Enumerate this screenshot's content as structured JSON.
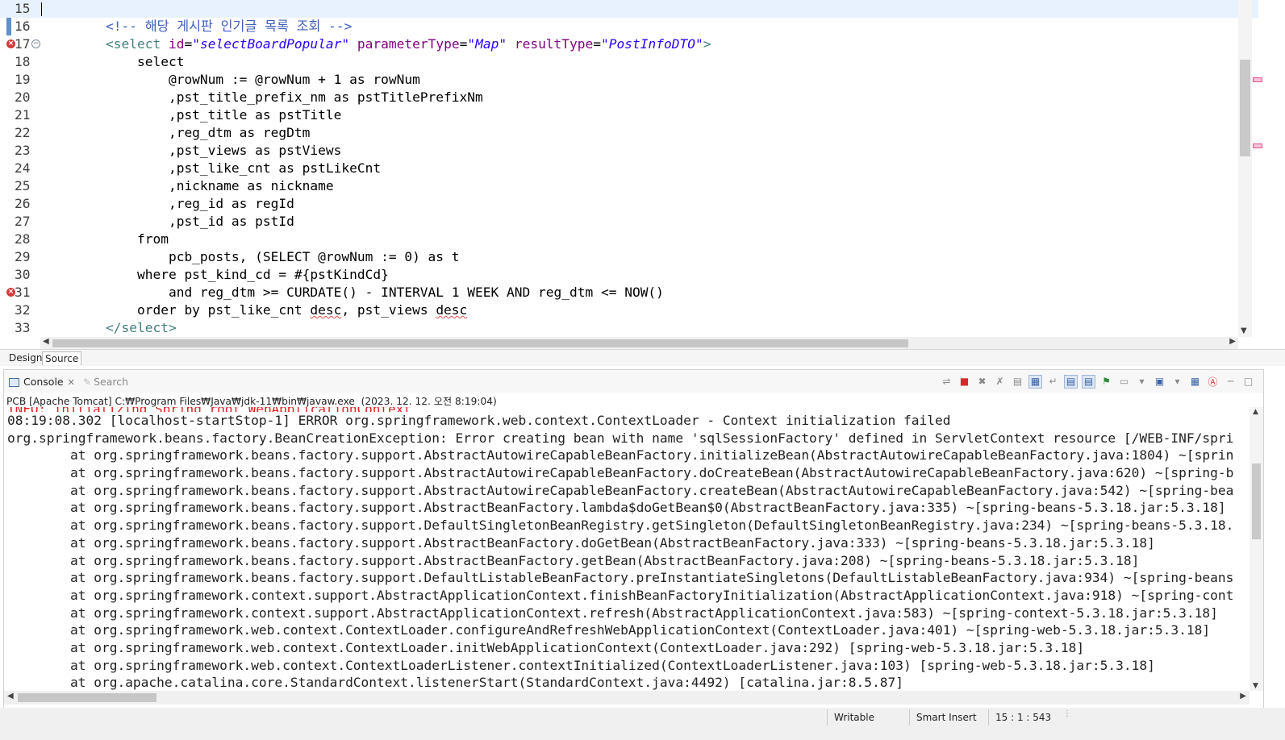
{
  "editor": {
    "lines": [
      {
        "n": "15",
        "segs": []
      },
      {
        "n": "16",
        "segs": [
          {
            "t": "    "
          },
          {
            "t": "<!-- 해당 게시판 인기글 목록 조회 -->",
            "c": "c-comment"
          }
        ]
      },
      {
        "n": "17",
        "segs": [
          {
            "t": "    "
          },
          {
            "t": "<select",
            "c": "c-tag"
          },
          {
            "t": " "
          },
          {
            "t": "id",
            "c": "c-attr"
          },
          {
            "t": "="
          },
          {
            "t": "\"selectBoardPopular\"",
            "c": "c-val"
          },
          {
            "t": " "
          },
          {
            "t": "parameterType",
            "c": "c-attr"
          },
          {
            "t": "="
          },
          {
            "t": "\"Map\"",
            "c": "c-val"
          },
          {
            "t": " "
          },
          {
            "t": "resultType",
            "c": "c-attr"
          },
          {
            "t": "="
          },
          {
            "t": "\"PostInfoDTO\"",
            "c": "c-val"
          },
          {
            "t": ">",
            "c": "c-tag"
          }
        ]
      },
      {
        "n": "18",
        "segs": [
          {
            "t": "        select"
          }
        ]
      },
      {
        "n": "19",
        "segs": [
          {
            "t": "            @rowNum := @rowNum + 1 as rowNum"
          }
        ]
      },
      {
        "n": "20",
        "segs": [
          {
            "t": "            ,pst_title_prefix_nm as pstTitlePrefixNm"
          }
        ]
      },
      {
        "n": "21",
        "segs": [
          {
            "t": "            ,pst_title as pstTitle"
          }
        ]
      },
      {
        "n": "22",
        "segs": [
          {
            "t": "            ,reg_dtm as regDtm"
          }
        ]
      },
      {
        "n": "23",
        "segs": [
          {
            "t": "            ,pst_views as pstViews"
          }
        ]
      },
      {
        "n": "24",
        "segs": [
          {
            "t": "            ,pst_like_cnt as pstLikeCnt"
          }
        ]
      },
      {
        "n": "25",
        "segs": [
          {
            "t": "            ,nickname as nickname"
          }
        ]
      },
      {
        "n": "26",
        "segs": [
          {
            "t": "            ,reg_id as regId"
          }
        ]
      },
      {
        "n": "27",
        "segs": [
          {
            "t": "            ,pst_id as pstId"
          }
        ]
      },
      {
        "n": "28",
        "segs": [
          {
            "t": "        from"
          }
        ]
      },
      {
        "n": "29",
        "segs": [
          {
            "t": "            pcb_posts, (SELECT @rowNum := 0) as t"
          }
        ]
      },
      {
        "n": "30",
        "segs": [
          {
            "t": "        where pst_kind_cd = #{pstKindCd}"
          }
        ]
      },
      {
        "n": "31",
        "segs": [
          {
            "t": "            and reg_dtm >= CURDATE() - INTERVAL 1 WEEK AND reg_dtm <= NOW()"
          }
        ]
      },
      {
        "n": "32",
        "segs": [
          {
            "t": "        order by pst_like_cnt "
          },
          {
            "t": "desc",
            "c": "squig"
          },
          {
            "t": ", pst_views "
          },
          {
            "t": "desc",
            "c": "squig"
          }
        ]
      },
      {
        "n": "33",
        "segs": [
          {
            "t": "    "
          },
          {
            "t": "</select>",
            "c": "c-tag"
          }
        ]
      }
    ],
    "error_lines": [
      "17",
      "31"
    ],
    "tabs": {
      "design": "Design",
      "source": "Source"
    }
  },
  "console": {
    "tab_label": "Console",
    "search_label": "Search",
    "process_line": "PCB [Apache Tomcat] C:₩Program Files₩Java₩jdk-11₩bin₩javaw.exe  (2023. 12. 12. 오전 8:19:04)",
    "partial_line": "INFO: Initializing Spring root WebApplicationContext",
    "lines": [
      {
        "t": "08:19:08.302 [localhost-startStop-1] ERROR org.springframework.web.context.ContextLoader - Context initialization failed"
      },
      {
        "t": "org.springframework.beans.factory.BeanCreationException: Error creating bean with name 'sqlSessionFactory' defined in ServletContext resource [/WEB-INF/spri"
      },
      {
        "t": "\tat org.springframework.beans.factory.support.AbstractAutowireCapableBeanFactory.initializeBean(AbstractAutowireCapableBeanFactory.java:1804) ~[sprin"
      },
      {
        "t": "\tat org.springframework.beans.factory.support.AbstractAutowireCapableBeanFactory.doCreateBean(AbstractAutowireCapableBeanFactory.java:620) ~[spring-b"
      },
      {
        "t": "\tat org.springframework.beans.factory.support.AbstractAutowireCapableBeanFactory.createBean(AbstractAutowireCapableBeanFactory.java:542) ~[spring-bea"
      },
      {
        "t": "\tat org.springframework.beans.factory.support.AbstractBeanFactory.lambda$doGetBean$0(AbstractBeanFactory.java:335) ~[spring-beans-5.3.18.jar:5.3.18]"
      },
      {
        "t": "\tat org.springframework.beans.factory.support.DefaultSingletonBeanRegistry.getSingleton(DefaultSingletonBeanRegistry.java:234) ~[spring-beans-5.3.18."
      },
      {
        "t": "\tat org.springframework.beans.factory.support.AbstractBeanFactory.doGetBean(AbstractBeanFactory.java:333) ~[spring-beans-5.3.18.jar:5.3.18]"
      },
      {
        "t": "\tat org.springframework.beans.factory.support.AbstractBeanFactory.getBean(AbstractBeanFactory.java:208) ~[spring-beans-5.3.18.jar:5.3.18]"
      },
      {
        "t": "\tat org.springframework.beans.factory.support.DefaultListableBeanFactory.preInstantiateSingletons(DefaultListableBeanFactory.java:934) ~[spring-beans"
      },
      {
        "t": "\tat org.springframework.context.support.AbstractApplicationContext.finishBeanFactoryInitialization(AbstractApplicationContext.java:918) ~[spring-cont"
      },
      {
        "t": "\tat org.springframework.context.support.AbstractApplicationContext.refresh(AbstractApplicationContext.java:583) ~[spring-context-5.3.18.jar:5.3.18]"
      },
      {
        "t": "\tat org.springframework.web.context.ContextLoader.configureAndRefreshWebApplicationContext(ContextLoader.java:401) ~[spring-web-5.3.18.jar:5.3.18]"
      },
      {
        "t": "\tat org.springframework.web.context.ContextLoader.initWebApplicationContext(ContextLoader.java:292) [spring-web-5.3.18.jar:5.3.18]"
      },
      {
        "t": "\tat org.springframework.web.context.ContextLoaderListener.contextInitialized(ContextLoaderListener.java:103) [spring-web-5.3.18.jar:5.3.18]"
      },
      {
        "t": "\tat org.apache.catalina.core.StandardContext.listenerStart(StandardContext.java:4492) [catalina.jar:8.5.87]"
      }
    ],
    "error_color": "#e02020",
    "toolbar_icons": [
      "disconnect-icon",
      "terminate-icon",
      "remove-launch-icon",
      "remove-all-icon",
      "clear-console-icon",
      "scroll-lock-icon",
      "word-wrap-icon",
      "show-on-stdout-icon",
      "show-on-stderr-icon",
      "pin-console-icon",
      "display-console-icon",
      "display-console-menu-icon",
      "open-console-icon",
      "open-console-menu-icon",
      "console-settings-icon",
      "console-a-icon",
      "minimize-icon",
      "maximize-icon"
    ]
  },
  "status": {
    "writable": "Writable",
    "insert_mode": "Smart Insert",
    "position": "15 : 1 : 543"
  }
}
